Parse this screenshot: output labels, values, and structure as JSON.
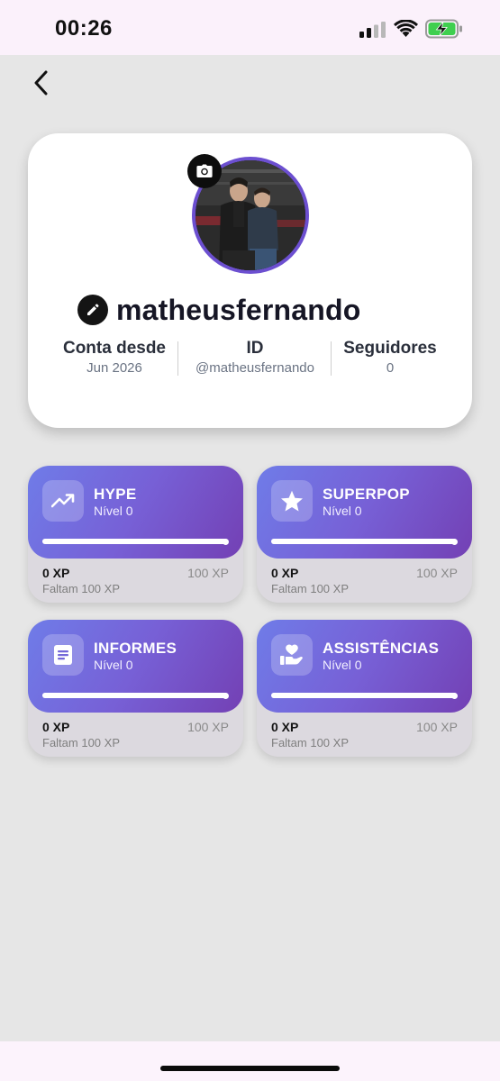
{
  "status_bar": {
    "time": "00:26",
    "icons": [
      "cellular-signal-icon",
      "wifi-icon",
      "battery-charging-icon"
    ]
  },
  "nav": {
    "back_icon": "chevron-left-icon"
  },
  "profile": {
    "username": "matheusfernando",
    "avatar_badge_icon": "camera-icon",
    "edit_icon": "pencil-icon",
    "stats": [
      {
        "label": "Conta desde",
        "value": "Jun 2026"
      },
      {
        "label": "ID",
        "value": "@matheusfernando"
      },
      {
        "label": "Seguidores",
        "value": "0"
      }
    ]
  },
  "levels": [
    {
      "title": "HYPE",
      "level": "Nível 0",
      "icon": "trending-up-icon",
      "xp_current": "0 XP",
      "xp_max": "100 XP",
      "remaining": "Faltam 100 XP",
      "progress": 1.0
    },
    {
      "title": "SUPERPOP",
      "level": "Nível 0",
      "icon": "star-icon",
      "xp_current": "0 XP",
      "xp_max": "100 XP",
      "remaining": "Faltam 100 XP",
      "progress": 1.0
    },
    {
      "title": "INFORMES",
      "level": "Nível 0",
      "icon": "document-icon",
      "xp_current": "0 XP",
      "xp_max": "100 XP",
      "remaining": "Faltam 100 XP",
      "progress": 1.0
    },
    {
      "title": "ASSISTÊNCIAS",
      "level": "Nível 0",
      "icon": "hand-heart-icon",
      "xp_current": "0 XP",
      "xp_max": "100 XP",
      "remaining": "Faltam 100 XP",
      "progress": 1.0
    }
  ],
  "colors": {
    "accent": "#6c4fd0",
    "card_gradient_start": "#6f7ce8",
    "card_gradient_end": "#7340b4",
    "background": "#e6e6e6"
  }
}
